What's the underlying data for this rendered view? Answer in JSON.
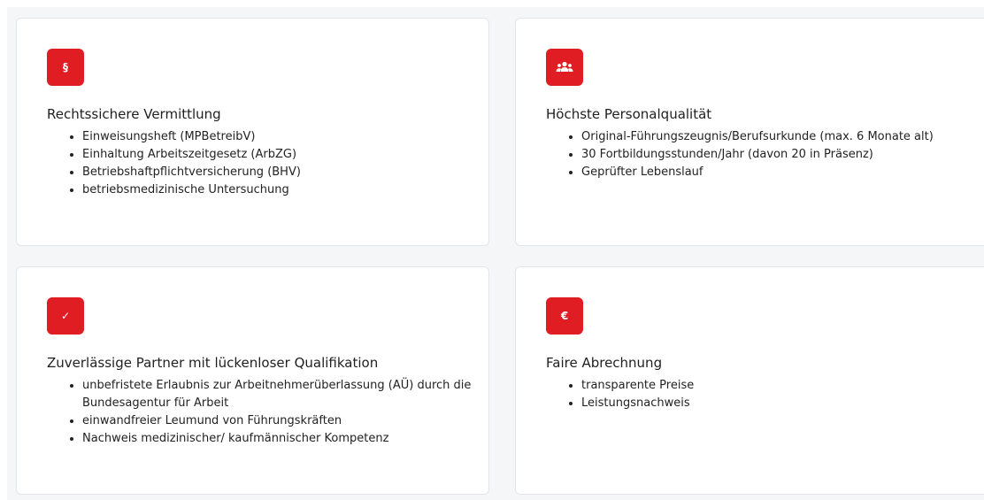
{
  "cards": [
    {
      "icon": "paragraph-icon",
      "icon_glyph": "§",
      "title": "Rechtssichere Vermittlung",
      "items": [
        "Einweisungsheft (MPBetreibV)",
        "Einhaltung Arbeitszeitgesetz (ArbZG)",
        "Betriebshaftpflichtversicherung (BHV)",
        "betriebsmedizinische Untersuchung"
      ]
    },
    {
      "icon": "users-icon",
      "icon_glyph": "",
      "title": "Höchste Personalqualität",
      "items": [
        "Original-Führungszeugnis/Berufsurkunde (max. 6 Monate alt)",
        "30 Fortbildungsstunden/Jahr (davon 20 in Präsenz)",
        "Geprüfter Lebenslauf"
      ]
    },
    {
      "icon": "checkmark-icon",
      "icon_glyph": "✓",
      "title": "Zuverlässige Partner mit lückenloser Qualifikation",
      "items": [
        "unbefristete Erlaubnis zur Arbeitnehmerüberlassung (AÜ) durch die Bundesagentur für Arbeit",
        "einwandfreier Leumund von Führungskräften",
        "Nachweis medizinischer/ kaufmännischer Kompetenz"
      ]
    },
    {
      "icon": "euro-icon",
      "icon_glyph": "€",
      "title": "Faire Abrechnung",
      "items": [
        "transparente Preise",
        "Leistungsnachweis"
      ]
    }
  ],
  "colors": {
    "accent": "#e11d24",
    "background": "#f5f6f8",
    "card": "#ffffff"
  }
}
